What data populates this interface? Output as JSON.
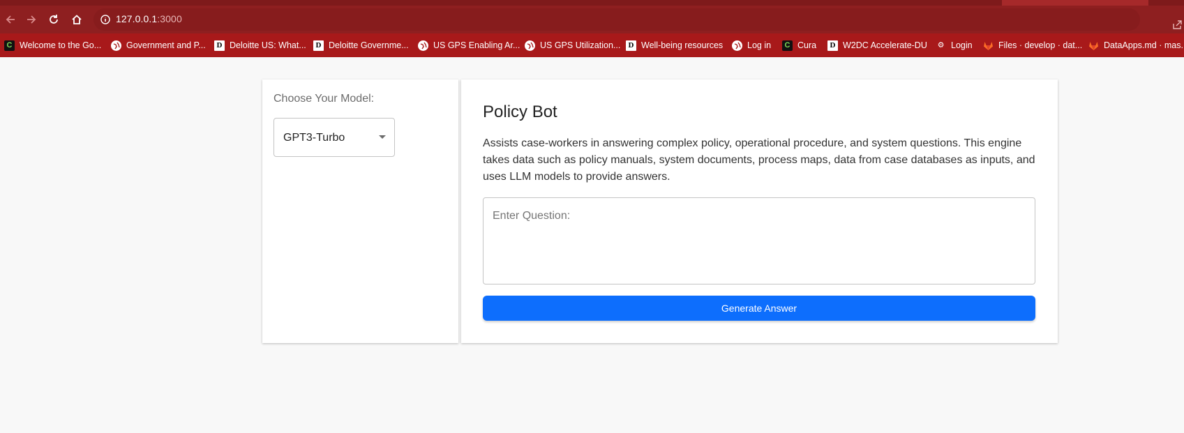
{
  "browser": {
    "url_host": "127.0.0.1",
    "url_port": ":3000",
    "bookmarks": [
      {
        "label": "Welcome to the Go...",
        "icon": "c-icon"
      },
      {
        "label": "Government and P...",
        "icon": "globe-icon"
      },
      {
        "label": "Deloitte US: What...",
        "icon": "d-icon"
      },
      {
        "label": "Deloitte Governme...",
        "icon": "d-icon"
      },
      {
        "label": "US GPS Enabling Ar...",
        "icon": "globe-icon"
      },
      {
        "label": "US GPS Utilization...",
        "icon": "globe-icon"
      },
      {
        "label": "Well-being resources",
        "icon": "d-icon"
      },
      {
        "label": "Log in",
        "icon": "globe-icon"
      },
      {
        "label": "Cura",
        "icon": "c-icon"
      },
      {
        "label": "W2DC Accelerate-DU",
        "icon": "d-icon"
      },
      {
        "label": "Login",
        "icon": "gear-icon"
      },
      {
        "label": "Files · develop · dat...",
        "icon": "gitlab-icon"
      },
      {
        "label": "DataApps.md · mas...",
        "icon": "gitlab-icon"
      }
    ],
    "colors": {
      "tabstrip": "#7e1a1b",
      "toolbar": "#8e1f20",
      "bookmarks_bar": "#a8191a"
    }
  },
  "sidebar": {
    "model_label": "Choose Your Model:",
    "selected_model": "GPT3-Turbo"
  },
  "main": {
    "title": "Policy Bot",
    "description": "Assists case-workers in answering complex policy, operational procedure, and system questions. This engine takes data such as policy manuals, system documents, process maps, data from case databases as inputs, and uses LLM models to provide answers.",
    "question_placeholder": "Enter Question:",
    "question_value": "",
    "generate_label": "Generate Answer",
    "accent_color": "#0d6efd"
  }
}
